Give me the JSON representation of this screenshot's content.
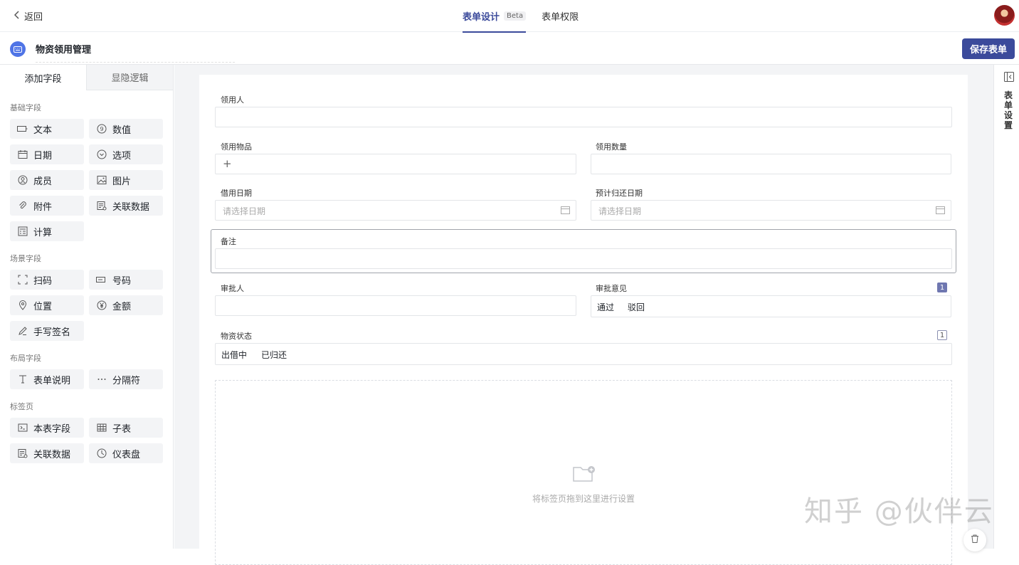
{
  "header": {
    "back_label": "返回",
    "tabs": [
      {
        "label": "表单设计",
        "badge": "Beta",
        "active": true
      },
      {
        "label": "表单权限",
        "active": false
      }
    ]
  },
  "subbar": {
    "app_title": "物资领用管理",
    "save_label": "保存表单"
  },
  "left_panel": {
    "tabs": [
      "添加字段",
      "显隐逻辑"
    ],
    "groups": [
      {
        "title": "基础字段",
        "items": [
          "文本",
          "数值",
          "日期",
          "选项",
          "成员",
          "图片",
          "附件",
          "关联数据",
          "计算"
        ]
      },
      {
        "title": "场景字段",
        "items": [
          "扫码",
          "号码",
          "位置",
          "金额",
          "手写签名"
        ]
      },
      {
        "title": "布局字段",
        "items": [
          "表单说明",
          "分隔符"
        ]
      },
      {
        "title": "标签页",
        "items": [
          "本表字段",
          "子表",
          "关联数据",
          "仪表盘"
        ]
      }
    ]
  },
  "form": {
    "fields": {
      "recipient": {
        "label": "领用人"
      },
      "item": {
        "label": "领用物品",
        "add_symbol": "+"
      },
      "quantity": {
        "label": "领用数量"
      },
      "borrow_date": {
        "label": "借用日期",
        "placeholder": "请选择日期"
      },
      "return_date": {
        "label": "预计归还日期",
        "placeholder": "请选择日期"
      },
      "note": {
        "label": "备注"
      },
      "approver": {
        "label": "审批人"
      },
      "opinion": {
        "label": "审批意见",
        "options": [
          "通过",
          "驳回"
        ],
        "badge": "1"
      },
      "status": {
        "label": "物资状态",
        "options": [
          "出借中",
          "已归还"
        ],
        "badge": "1"
      }
    },
    "dropzone_text": "将标签页拖到这里进行设置"
  },
  "right_panel": {
    "label": "表单设置"
  },
  "watermark": "知乎 @伙伴云",
  "colors": {
    "accent": "#3b4a9b",
    "app_icon": "#4f74e6"
  }
}
